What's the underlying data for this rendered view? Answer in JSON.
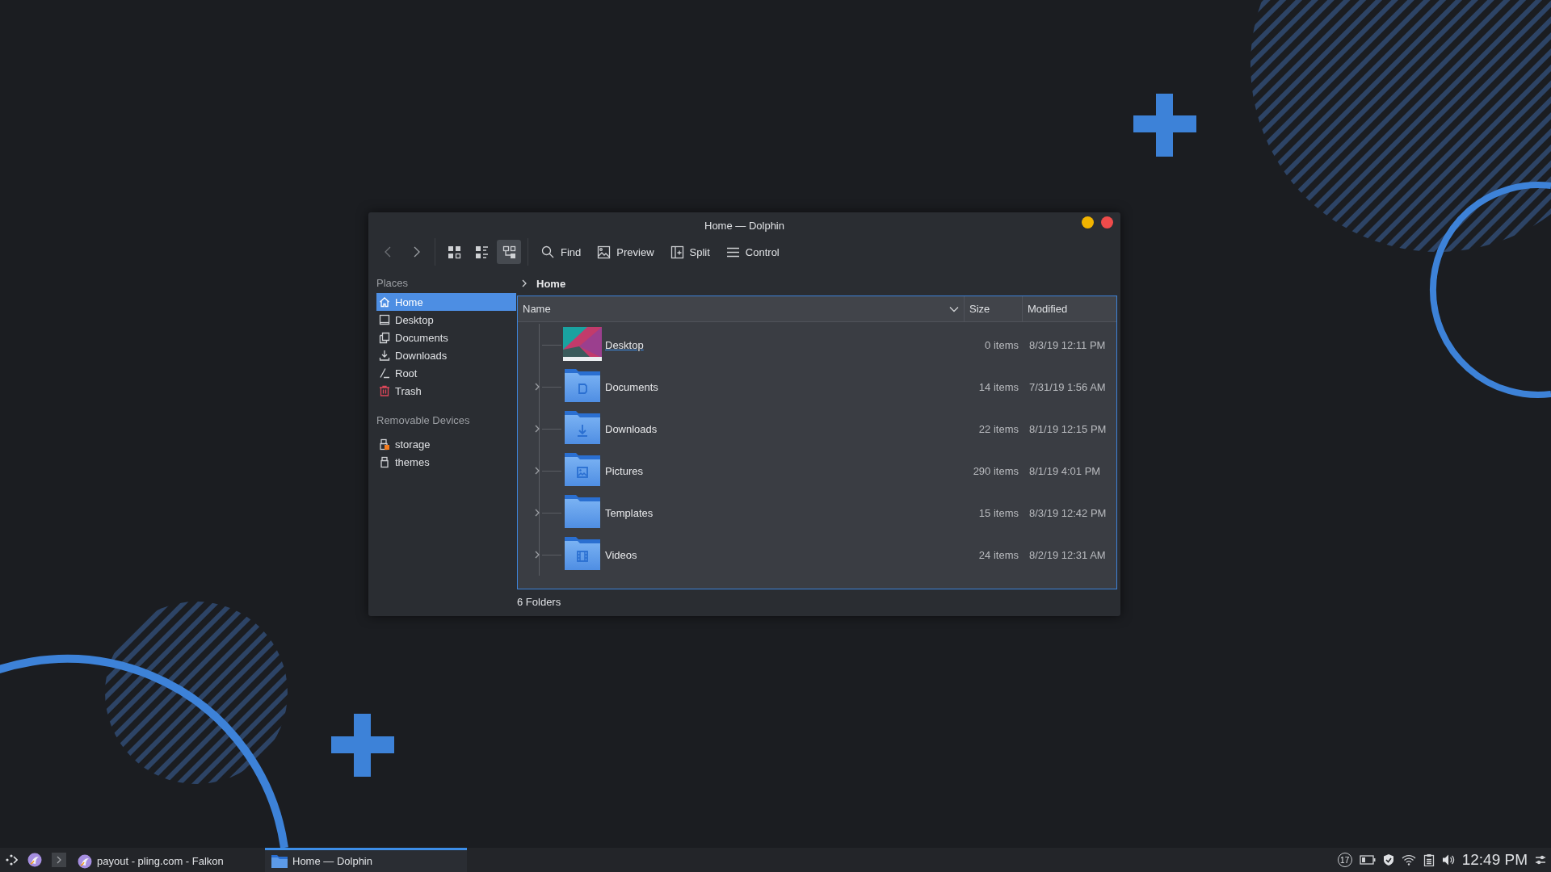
{
  "window": {
    "title": "Home — Dolphin"
  },
  "toolbar": {
    "view_modes": [
      {
        "kind": "icons",
        "selected": false
      },
      {
        "kind": "compact",
        "selected": false
      },
      {
        "kind": "details",
        "selected": true
      }
    ],
    "actions": [
      {
        "kind": "search",
        "label": "Find"
      },
      {
        "kind": "image",
        "label": "Preview"
      },
      {
        "kind": "split",
        "label": "Split"
      },
      {
        "kind": "menu",
        "label": "Control"
      }
    ]
  },
  "sidebar": {
    "sections": [
      {
        "title": "Places",
        "items": [
          {
            "kind": "home",
            "label": "Home",
            "selected": true
          },
          {
            "kind": "desktop",
            "label": "Desktop",
            "selected": false
          },
          {
            "kind": "documents",
            "label": "Documents",
            "selected": false
          },
          {
            "kind": "downloads",
            "label": "Downloads",
            "selected": false
          },
          {
            "kind": "root",
            "label": "Root",
            "selected": false
          },
          {
            "kind": "trash",
            "label": "Trash",
            "selected": false
          }
        ]
      },
      {
        "title": "Removable Devices",
        "items": [
          {
            "kind": "drive",
            "label": "storage",
            "selected": false
          },
          {
            "kind": "usb",
            "label": "themes",
            "selected": false
          }
        ]
      }
    ]
  },
  "breadcrumb": [
    "Home"
  ],
  "table": {
    "columns": [
      {
        "label": "Name",
        "sorted": true
      },
      {
        "label": "Size",
        "sorted": false
      },
      {
        "label": "Modified",
        "sorted": false
      }
    ],
    "rows": [
      {
        "kind": "desktop",
        "name": "Desktop",
        "size": "0 items",
        "modified": "8/3/19 12:11 PM",
        "expandable": false,
        "hovered": true
      },
      {
        "kind": "documents",
        "name": "Documents",
        "size": "14 items",
        "modified": "7/31/19 1:56 AM",
        "expandable": true,
        "hovered": false
      },
      {
        "kind": "downloads",
        "name": "Downloads",
        "size": "22 items",
        "modified": "8/1/19 12:15 PM",
        "expandable": true,
        "hovered": false
      },
      {
        "kind": "pictures",
        "name": "Pictures",
        "size": "290 items",
        "modified": "8/1/19 4:01 PM",
        "expandable": true,
        "hovered": false
      },
      {
        "kind": "templates",
        "name": "Templates",
        "size": "15 items",
        "modified": "8/3/19 12:42 PM",
        "expandable": true,
        "hovered": false
      },
      {
        "kind": "videos",
        "name": "Videos",
        "size": "24 items",
        "modified": "8/2/19 12:31 AM",
        "expandable": true,
        "hovered": false
      }
    ]
  },
  "status_bar": "6 Folders",
  "taskbar": {
    "tasks": [
      {
        "kind": "browser",
        "label": "payout - pling.com - Falkon",
        "active": false
      },
      {
        "kind": "folder",
        "label": "Home — Dolphin",
        "active": true
      }
    ],
    "notifications": "17",
    "clock": "12:49 PM"
  }
}
